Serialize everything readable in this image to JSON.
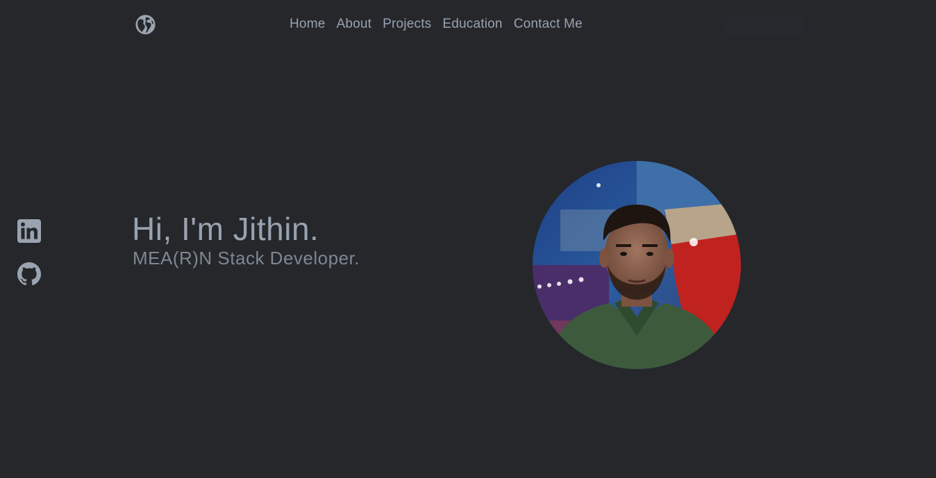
{
  "header": {
    "logo_icon": "globe-icon",
    "nav": [
      {
        "label": "Home"
      },
      {
        "label": "About"
      },
      {
        "label": "Projects"
      },
      {
        "label": "Education"
      },
      {
        "label": "Contact Me"
      }
    ]
  },
  "social": {
    "items": [
      {
        "icon": "linkedin-icon"
      },
      {
        "icon": "github-icon"
      }
    ]
  },
  "hero": {
    "title": "Hi, I'm Jithin.",
    "subtitle": "MEA(R)N Stack Developer."
  },
  "colors": {
    "background": "#25272b",
    "text": "#98a3b1",
    "subtext": "#7e8893"
  }
}
